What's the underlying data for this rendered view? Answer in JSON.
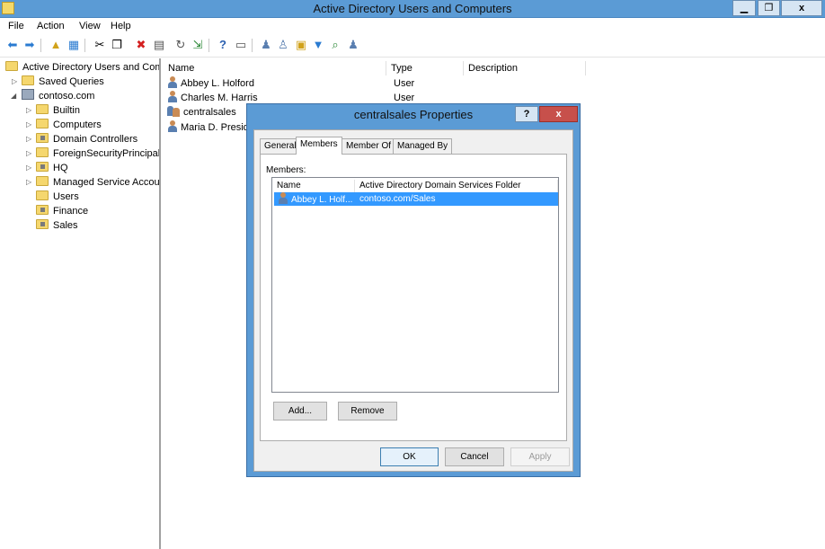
{
  "window": {
    "title": "Active Directory Users and Computers",
    "min_glyph": "▁",
    "max_glyph": "❐",
    "close_glyph": "x"
  },
  "menu": [
    "File",
    "Action",
    "View",
    "Help"
  ],
  "toolbar_icons": [
    "back-icon",
    "forward-icon",
    "up-icon",
    "show-hide-tree-icon",
    "cut-icon",
    "copy-icon",
    "delete-icon",
    "properties-icon",
    "refresh-icon",
    "export-icon",
    "help-icon",
    "console-icon",
    "new-user-icon",
    "new-group-icon",
    "new-ou-icon",
    "filter-icon",
    "find-icon",
    "add-to-group-icon"
  ],
  "tree": {
    "root": "Active Directory Users and Com",
    "items": [
      {
        "label": "Saved Queries",
        "expander": "▷",
        "type": "folder"
      },
      {
        "label": "contoso.com",
        "expander": "◢",
        "type": "domain"
      },
      {
        "label": "Builtin",
        "expander": "▷",
        "type": "folder"
      },
      {
        "label": "Computers",
        "expander": "▷",
        "type": "folder"
      },
      {
        "label": "Domain Controllers",
        "expander": "▷",
        "type": "ou"
      },
      {
        "label": "ForeignSecurityPrincipals",
        "expander": "▷",
        "type": "folder"
      },
      {
        "label": "HQ",
        "expander": "▷",
        "type": "ou"
      },
      {
        "label": "Managed Service Accour",
        "expander": "▷",
        "type": "folder"
      },
      {
        "label": "Users",
        "expander": "",
        "type": "folder"
      },
      {
        "label": "Finance",
        "expander": "",
        "type": "ou"
      },
      {
        "label": "Sales",
        "expander": "",
        "type": "ou"
      }
    ]
  },
  "list": {
    "columns": [
      "Name",
      "Type",
      "Description"
    ],
    "rows": [
      {
        "name": "Abbey L. Holford",
        "type": "User",
        "icon": "user-icon"
      },
      {
        "name": "Charles M. Harris",
        "type": "User",
        "icon": "user-icon"
      },
      {
        "name": "centralsales",
        "type": "",
        "icon": "group-icon"
      },
      {
        "name": "Maria D. Preside",
        "type": "",
        "icon": "user-icon"
      }
    ]
  },
  "dialog": {
    "title": "centralsales Properties",
    "help_glyph": "?",
    "close_glyph": "x",
    "tabs": [
      "General",
      "Members",
      "Member Of",
      "Managed By"
    ],
    "active_tab": "Members",
    "members_label": "Members:",
    "members_columns": [
      "Name",
      "Active Directory Domain Services Folder"
    ],
    "members": [
      {
        "name": "Abbey L. Holf...",
        "folder": "contoso.com/Sales"
      }
    ],
    "add_label": "Add...",
    "remove_label": "Remove",
    "ok_label": "OK",
    "cancel_label": "Cancel",
    "apply_label": "Apply"
  }
}
